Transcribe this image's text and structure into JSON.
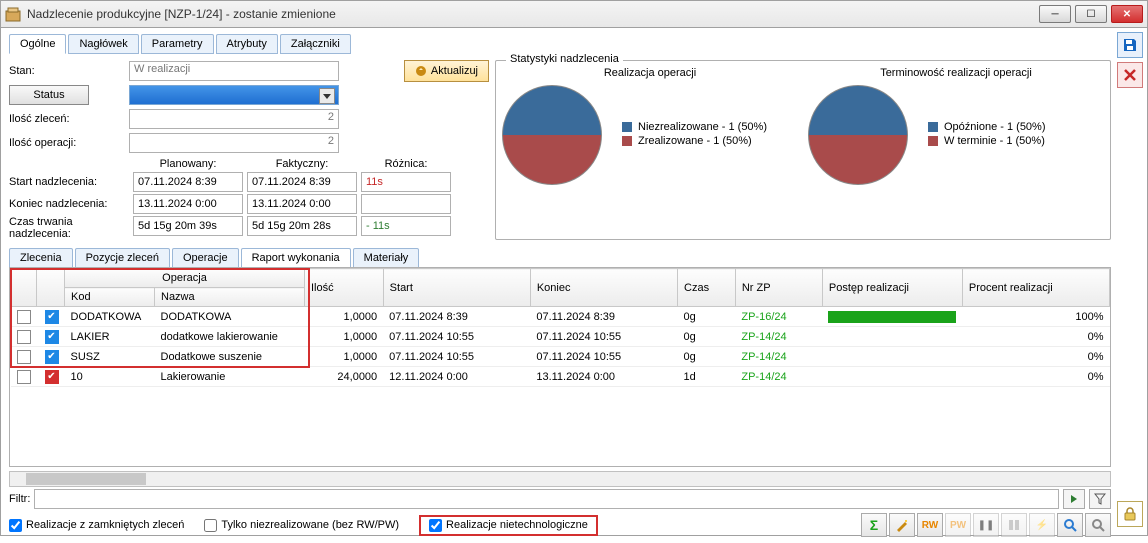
{
  "window": {
    "title": "Nadzlecenie produkcyjne [NZP-1/24] - zostanie zmienione"
  },
  "main_tabs": [
    "Ogólne",
    "Nagłówek",
    "Parametry",
    "Atrybuty",
    "Załączniki"
  ],
  "form": {
    "stan_label": "Stan:",
    "stan_value": "W realizacji",
    "status_btn": "Status",
    "ilosc_zlecen_label": "Ilość zleceń:",
    "ilosc_zlecen_value": "2",
    "ilosc_operacji_label": "Ilość operacji:",
    "ilosc_operacji_value": "2",
    "aktualizuj_btn": "Aktualizuj",
    "col_planowany": "Planowany:",
    "col_faktyczny": "Faktyczny:",
    "col_roznica": "Różnica:",
    "start_label": "Start nadzlecenia:",
    "koniec_label": "Koniec nadzlecenia:",
    "czas_label": "Czas trwania nadzlecenia:",
    "start_plan": "07.11.2024 8:39",
    "start_fakt": "07.11.2024 8:39",
    "start_diff": "11s",
    "koniec_plan": "13.11.2024 0:00",
    "koniec_fakt": "13.11.2024 0:00",
    "koniec_diff": "",
    "czas_plan": "5d 15g 20m 39s",
    "czas_fakt": "5d 15g 20m 28s",
    "czas_diff": "- 11s"
  },
  "stats": {
    "legend": "Statystyki nadzlecenia",
    "chart1_title": "Realizacja operacji",
    "chart1_items": [
      "Niezrealizowane - 1 (50%)",
      "Zrealizowane - 1 (50%)"
    ],
    "chart2_title": "Terminowość realizacji operacji",
    "chart2_items": [
      "Opóźnione - 1 (50%)",
      "W terminie - 1 (50%)"
    ]
  },
  "chart_data": [
    {
      "type": "pie",
      "title": "Realizacja operacji",
      "series": [
        {
          "name": "Niezrealizowane",
          "value": 1,
          "percent": 50,
          "color": "#3a6b9a"
        },
        {
          "name": "Zrealizowane",
          "value": 1,
          "percent": 50,
          "color": "#a94b4b"
        }
      ]
    },
    {
      "type": "pie",
      "title": "Terminowość realizacji operacji",
      "series": [
        {
          "name": "Opóźnione",
          "value": 1,
          "percent": 50,
          "color": "#3a6b9a"
        },
        {
          "name": "W terminie",
          "value": 1,
          "percent": 50,
          "color": "#a94b4b"
        }
      ]
    }
  ],
  "sub_tabs": [
    "Zlecenia",
    "Pozycje zleceń",
    "Operacje",
    "Raport wykonania",
    "Materiały"
  ],
  "grid": {
    "group_operacja": "Operacja",
    "headers": {
      "kod": "Kod",
      "nazwa": "Nazwa",
      "ilosc": "Ilość",
      "start": "Start",
      "koniec": "Koniec",
      "czas": "Czas",
      "nrzp": "Nr ZP",
      "postep": "Postęp realizacji",
      "procent": "Procent realizacji"
    },
    "rows": [
      {
        "state": "blue",
        "kod": "DODATKOWA",
        "nazwa": "DODATKOWA",
        "ilosc": "1,0000",
        "start": "07.11.2024 8:39",
        "koniec": "07.11.2024 8:39",
        "czas": "0g",
        "nrzp": "ZP-16/24",
        "procent": "100%",
        "progress": 100
      },
      {
        "state": "blue",
        "kod": "LAKIER",
        "nazwa": "dodatkowe lakierowanie",
        "ilosc": "1,0000",
        "start": "07.11.2024 10:55",
        "koniec": "07.11.2024 10:55",
        "czas": "0g",
        "nrzp": "ZP-14/24",
        "procent": "0%",
        "progress": 0
      },
      {
        "state": "blue",
        "kod": "SUSZ",
        "nazwa": "Dodatkowe suszenie",
        "ilosc": "1,0000",
        "start": "07.11.2024 10:55",
        "koniec": "07.11.2024 10:55",
        "czas": "0g",
        "nrzp": "ZP-14/24",
        "procent": "0%",
        "progress": 0
      },
      {
        "state": "red",
        "kod": "10",
        "nazwa": "Lakierowanie",
        "ilosc": "24,0000",
        "start": "12.11.2024 0:00",
        "koniec": "13.11.2024 0:00",
        "czas": "1d",
        "nrzp": "ZP-14/24",
        "procent": "0%",
        "progress": 0
      }
    ]
  },
  "filter": {
    "label": "Filtr:"
  },
  "options": {
    "closed": "Realizacje z zamkniętych zleceń",
    "unrealized": "Tylko niezrealizowane (bez RW/PW)",
    "nontech": "Realizacje nietechnologiczne"
  }
}
